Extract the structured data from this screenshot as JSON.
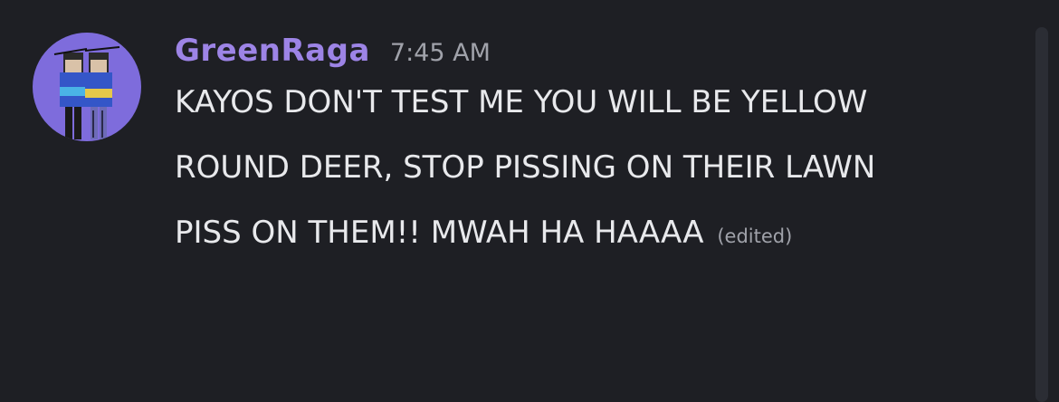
{
  "message": {
    "username": "GreenRaga",
    "timestamp": "7:45 AM",
    "lines": [
      "KAYOS DON'T TEST ME YOU WILL BE YELLOW",
      "ROUND DEER, STOP PISSING ON THEIR LAWN",
      "PISS ON THEM!! MWAH HA HAAAA"
    ],
    "edited_label": "(edited)"
  },
  "avatar": {
    "icon": "roblox-characters-avatar"
  },
  "colors": {
    "background": "#1e1f24",
    "username": "#9d84e6",
    "text": "#e8e9ec",
    "muted": "#a0a2aa",
    "avatar_bg": "#7e6cdc"
  }
}
